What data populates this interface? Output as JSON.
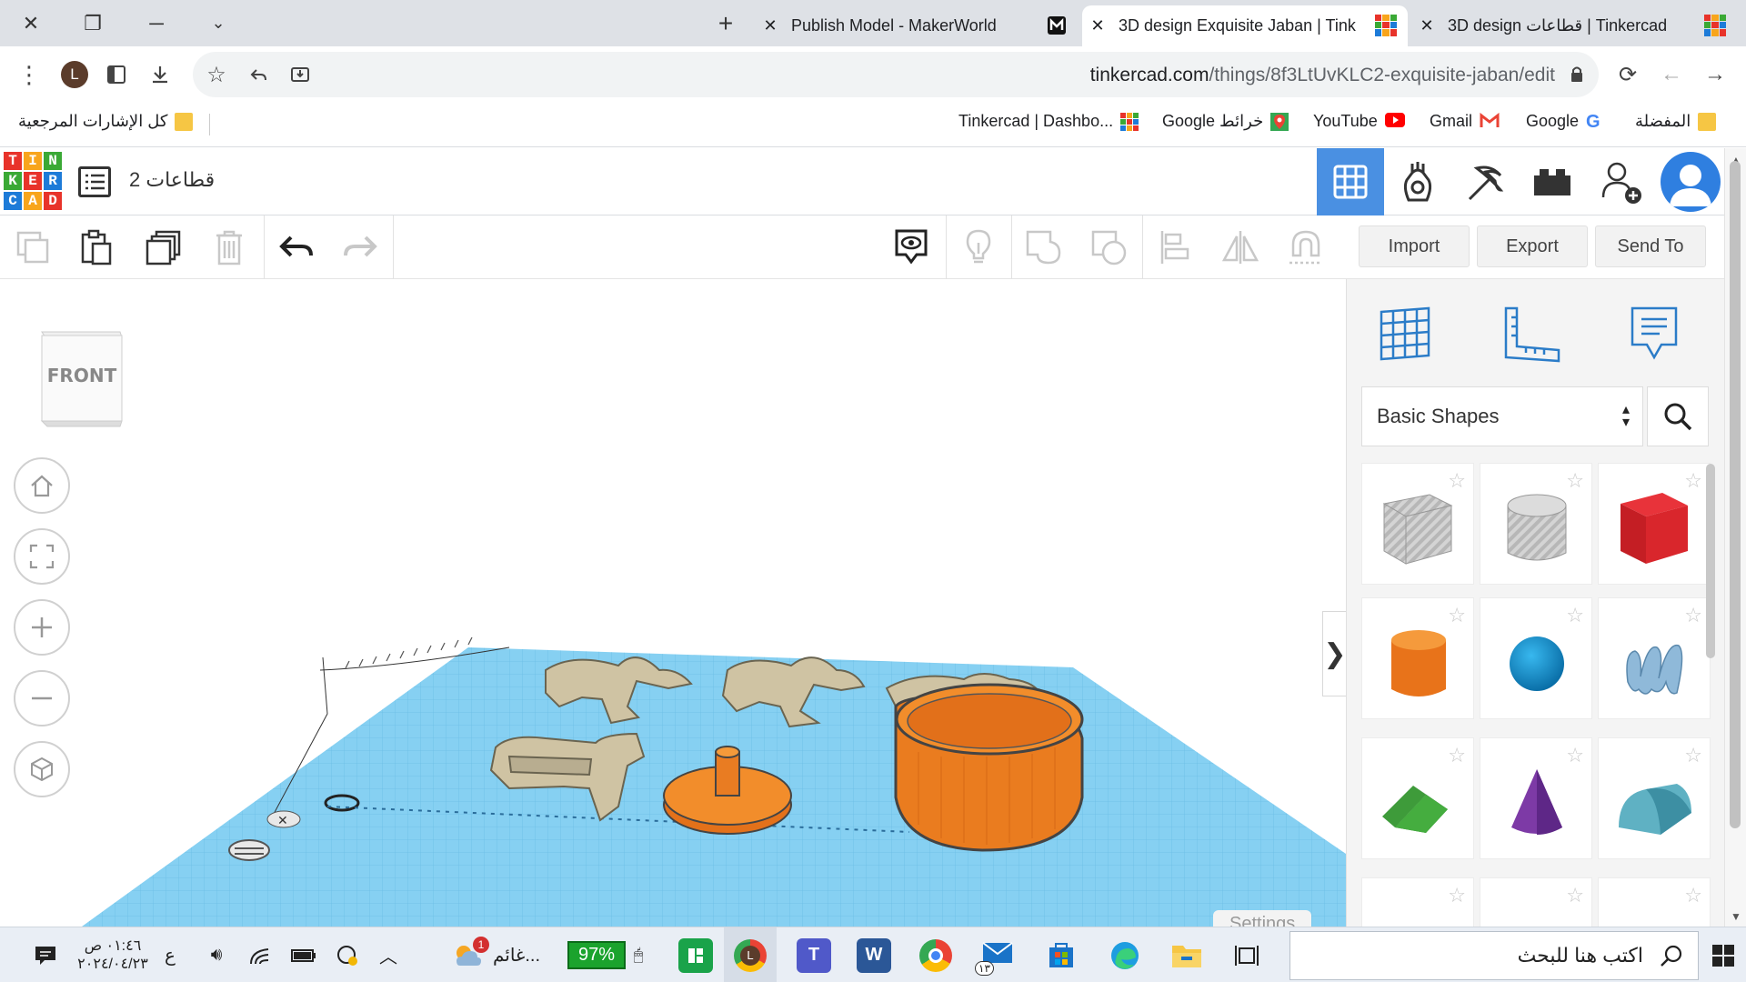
{
  "browser": {
    "tabs": [
      {
        "title": "Publish Model - MakerWorld",
        "active": false
      },
      {
        "title": "3D design Exquisite Jaban | Tink",
        "active": true
      },
      {
        "title": "3D design قطاعات | Tinkercad",
        "active": false
      }
    ],
    "url_host": "tinkercad.com",
    "url_path": "/things/8f3LtUvKLC2-exquisite-jaban/edit",
    "profile_initial": "L"
  },
  "bookmarks": {
    "all_bookmarks": "كل الإشارات المرجعية",
    "items": [
      "Tinkercad | Dashbo...",
      "Google خرائط",
      "YouTube",
      "Gmail",
      "Google",
      "المفضلة"
    ]
  },
  "tinkercad": {
    "logo_letters": [
      "T",
      "I",
      "N",
      "K",
      "E",
      "R",
      "C",
      "A",
      "D"
    ],
    "design_title": "قطاعات 2",
    "actions": {
      "import": "Import",
      "export": "Export",
      "send_to": "Send To"
    },
    "viewcube_face": "FRONT",
    "settings_label": "Settings",
    "library": {
      "selected": "Basic Shapes",
      "shapes": [
        "box-striped",
        "cylinder-striped",
        "box",
        "cylinder",
        "sphere",
        "scribble",
        "roof",
        "cone",
        "round-roof"
      ]
    }
  },
  "taskbar": {
    "search_placeholder": "اكتب هنا للبحث",
    "weather": "غائم...",
    "battery": "97%",
    "time": "٠١:٤٦ ص",
    "date": "٢٠٢٤/٠٤/٢٣",
    "lang": "ع",
    "mail_badge": "١٣",
    "weather_badge": "1"
  },
  "colors": {
    "accent": "#4a90e2",
    "tinkercad_blue": "#2f7fe0",
    "workplane": "#7fcdf0",
    "orange": "#f07f1e",
    "tan": "#c9bd9e"
  }
}
